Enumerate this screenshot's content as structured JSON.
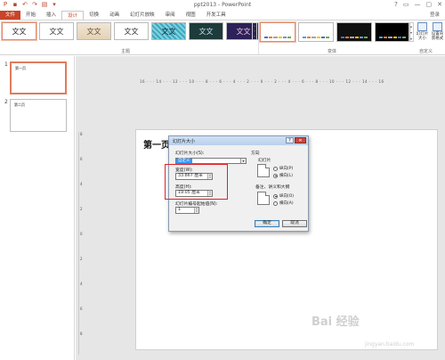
{
  "window": {
    "title": "ppt2013 - PowerPoint",
    "controls": [
      "?",
      "▭",
      "—",
      "▢",
      "✕"
    ]
  },
  "tabs": [
    {
      "label": "文件",
      "kind": "file"
    },
    {
      "label": "开始"
    },
    {
      "label": "插入"
    },
    {
      "label": "设计",
      "kind": "active"
    },
    {
      "label": "切换"
    },
    {
      "label": "动画"
    },
    {
      "label": "幻灯片放映"
    },
    {
      "label": "审阅"
    },
    {
      "label": "视图"
    },
    {
      "label": "开发工具"
    }
  ],
  "login_label": "登录",
  "ribbon": {
    "theme_label": "文文",
    "themes": [
      "文文",
      "文文",
      "文文",
      "文文",
      "文文",
      "文文",
      "文文"
    ],
    "group_themes": "主题",
    "group_variants": "变体",
    "group_customize": "自定义",
    "slide_size_button": "幻灯片大小",
    "format_bg_button": "设置背景格式"
  },
  "slides_pane": {
    "items": [
      {
        "number": "1",
        "title": "第一页",
        "selected": true
      },
      {
        "number": "2",
        "title": "第二页",
        "selected": false
      }
    ]
  },
  "ruler": {
    "horizontal": "16 · · · 14 · · · 12 · · · 10 · · · 8 · · · 6 · · · 4 · · · 2 · · · 0 · · · 2 · · · 4 · · · 6 · · · 8 · · · 10 · · · 12 · · · 14 · · · 16",
    "vertical": [
      "8",
      "6",
      "4",
      "2",
      "0",
      "2",
      "4",
      "6",
      "8"
    ]
  },
  "slide": {
    "title": "第一页"
  },
  "dialog": {
    "title": "幻灯片大小",
    "size_label": "幻灯片大小(S):",
    "size_value": "自定义",
    "width_label": "宽度(W):",
    "width_value": "33.867 厘米",
    "height_label": "高度(H):",
    "height_value": "19.05 厘米",
    "start_label": "幻灯片编号起始值(N):",
    "start_value": "1",
    "orientation_label": "方向",
    "slides_label": "幻灯片",
    "portrait": "纵向(P)",
    "landscape": "横向(L)",
    "notes_label": "备注、讲义和大纲",
    "notes_portrait": "纵向(O)",
    "notes_landscape": "横向(A)",
    "ok": "确定",
    "cancel": "取消"
  },
  "watermark": {
    "logo": "Bai 经验",
    "sub": "jingyan.baidu.com"
  },
  "colors": {
    "accent": "#c8442a",
    "highlight": "#e0212a",
    "selection": "#3399ff"
  }
}
